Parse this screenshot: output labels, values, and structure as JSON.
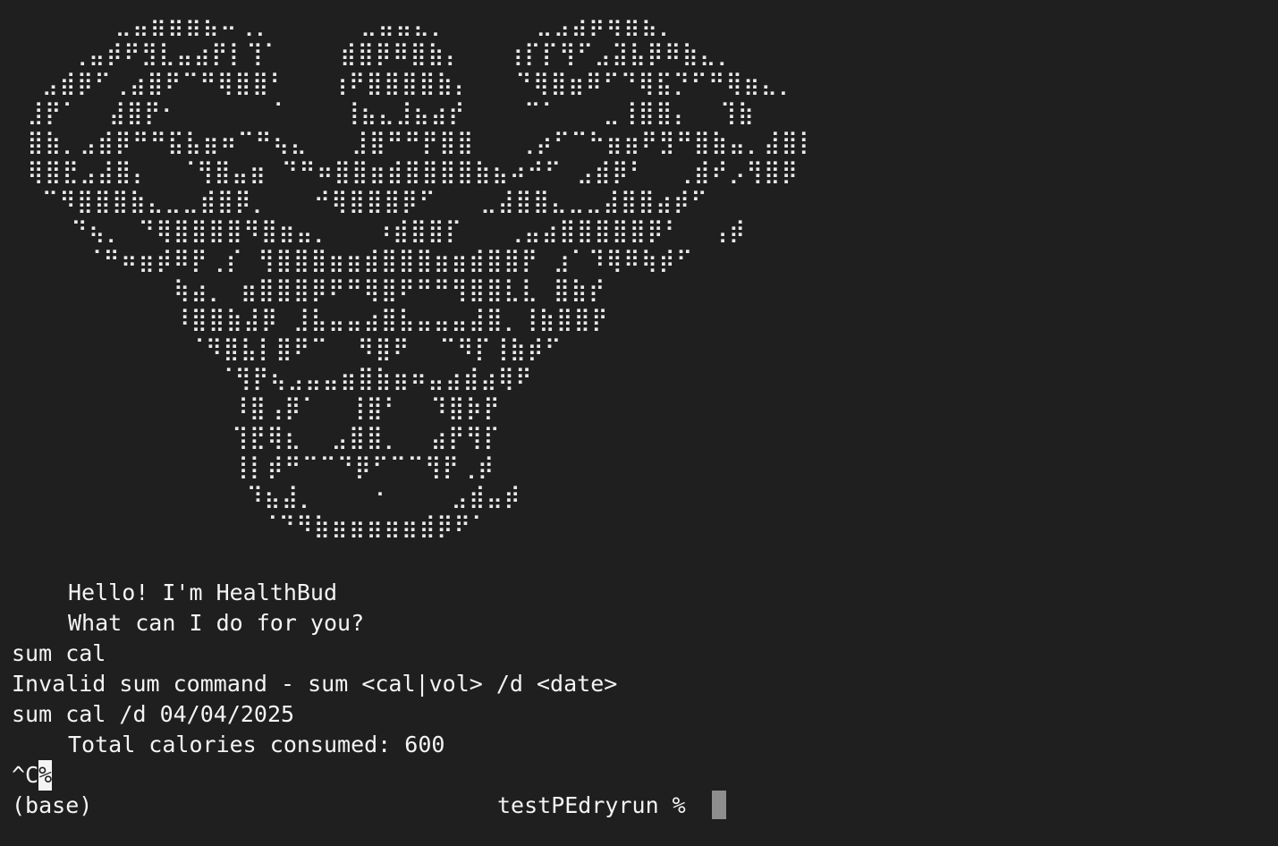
{
  "terminal": {
    "ascii_art": [
      "       ⣀⣤⣶⣶⣶⣦⠤⢀⡀      ⣀⣤⣤⣄⡀      ⣀⣠⣴⡶⢶⣶⣦⡀",
      "    ⢀⣤⡾⠟⣻⣇⣤⣴⡟⡇⢹⠁    ⣾⣿⡿⠿⣿⣷⡄   ⢰⡏⡏⢻⠋⣠⣽⣧⡿⠿⣷⣄⡀",
      "  ⣠⣾⡿⠋⢀⣴⣿⠟⠉⠛⢿⣿⣿⠃   ⢰⠟⣿⣿⣿⣿⣷⡄   ⠙⢿⣿⣶⠿⠋⠙⢿⣯⡙⠋⠛⢿⣶⣄⡀",
      " ⣸⡟⠁  ⣼⣿⡟⠂      ⠈    ⢸⣦⣄⣸⣦⣴⡞    ⠉⠁   ⣀⢸⣿⣿⡄  ⢹⣷",
      " ⣿⣷⡀⣠⣾⡿⠛⠛⣯⣧⣶⠶⠉⠛⢦⣄   ⣸⣿⠛⠛⡟⣿⣿   ⢀⡴⠋⠉⠓⣶⣶⠟⣻⠛⣿⣷⣤⡀⣼⣿⡇",
      " ⢿⣿⣟⣠⣼⣿⡄  ⠈⢻⣿⣤⣶ ⠙⠛⠶⣿⣿⣶⣾⣿⣿⣿⣿⣷⣦⠴⠚⠋ ⣠⣾⡿⠃  ⢀⣾⠞⡠⢻⣿⡿",
      "  ⠉⠻⣿⣿⣿⣷⣄⣀⣀⣾⣿⡿⡀   ⠚⢿⣿⣿⣿⡿⠋   ⣀⣼⣿⣿⣄⣀⣀⣼⣿⣿⣴⡾⠋",
      "    ⠙⢦⡀ ⠙⢿⣿⣿⣿⣿⠻⣿⣶⣤⡀   ⠰⣾⣿⣿⡏   ⢀⣤⣴⣿⣿⣿⣿⣿⡿⠃  ⢠⡾",
      "     ⠈⠛⠶⣶⡾⠿⡟⢀⡎ ⢻⣿⣿⣿⣶⣶⣾⣿⣿⣿⣶⣶⣾⣿⣿⡟ ⣰⠁⠹⢿⠿⢷⡾⠋",
      "           ⢷⣴⡀ ⣶⣿⣿⣿⡿⠟⠛⢿⣿⠟⠛⠛⢻⣿⣿⣇⣇ ⣿⣷⡞",
      "           ⠸⣿⣿⣷⣼⡿ ⣸⣧⣤⣤⣴⣿⣧⣤⣤⣤⣼⣿⡀⢸⣷⣿⣿⡟",
      "            ⠈⠻⣿⣧⡇⣿⠟⠉  ⠻⣿⠟  ⠉⠻⡏⢸⣷⡾⠋",
      "              ⠈⢻⡟⢦⣠⣤⣤⣶⣿⣷⣶⠶⣤⣴⣾⣴⢿⠟",
      "               ⠸⣿⢠⡿⠁  ⢸⣿⠃  ⠹⣿⡷⡟",
      "               ⢹⣟⢿⣆  ⣠⣿⣿⡀  ⣴⡟⢻⡏",
      "               ⢸⡇⡾⠛⠉⠉⠙⡿⠋⠉⠉⢻⡟⢀⡾",
      "                ⠹⣦⣼⡀    ⠂    ⣠⣾⣤⡾",
      "                 ⠈⠙⠻⣷⣶⣶⣶⣶⣶⣾⡿⠟⠁"
    ],
    "lines": {
      "greeting": "Hello! I'm HealthBud",
      "question": "What can I do for you?",
      "cmd1": "sum cal",
      "error": "Invalid sum command - sum <cal|vol> /d <date>",
      "cmd2": "sum cal /d 04/04/2025",
      "result": "Total calories consumed: 600",
      "interrupt_prefix": "^C",
      "interrupt_percent": "%",
      "env": "(base)",
      "prompt": "testPEdryrun %"
    }
  }
}
